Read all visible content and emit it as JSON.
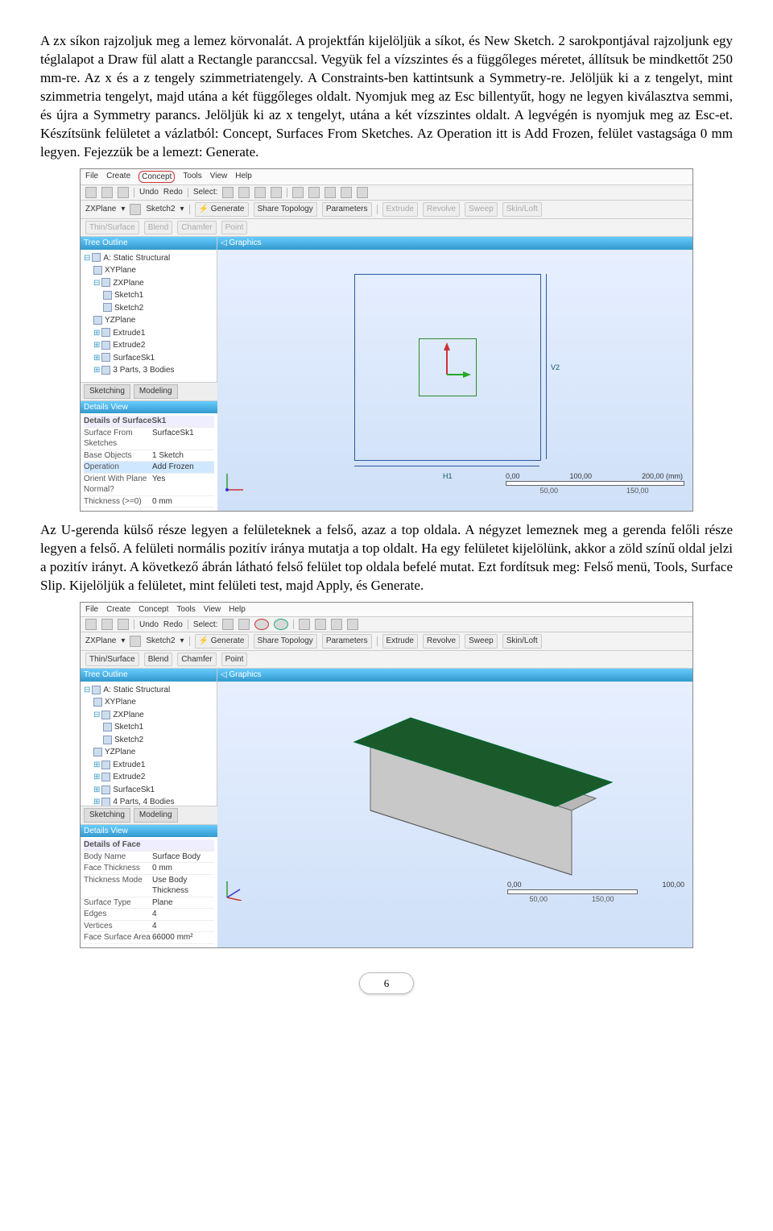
{
  "para1": "A zx síkon rajzoljuk meg a lemez körvonalát. A projektfán kijelöljük a síkot, és New Sketch. 2 sarokpontjával rajzoljunk egy téglalapot a Draw fül alatt a Rectangle paranccsal. Vegyük fel a vízszintes és a függőleges méretet, állítsuk be mindkettőt 250 mm-re. Az x és a z tengely szimmetriatengely. A Constraints-ben kattintsunk a Symmetry-re. Jelöljük ki a z tengelyt, mint szimmetria tengelyt, majd utána a két függőleges oldalt. Nyomjuk meg az Esc billentyűt, hogy ne legyen kiválasztva semmi, és újra a Symmetry parancs. Jelöljük ki az x tengelyt, utána a két vízszintes oldalt. A legvégén is nyomjuk meg az Esc-et. Készítsünk felületet a vázlatból: Concept, Surfaces From Sketches. Az Operation itt is Add Frozen, felület vastagsága 0 mm legyen. Fejezzük be a lemezt: Generate.",
  "para2": "Az U-gerenda külső része legyen a felületeknek a felső, azaz a top oldala. A négyzet lemeznek meg a gerenda felőli része legyen a felső. A felületi normális pozitív iránya mutatja a top oldalt. Ha egy felületet kijelölünk, akkor a zöld színű oldal jelzi a pozitív irányt. A következő ábrán látható felső felület top oldala befelé mutat. Ezt fordítsuk meg: Felső menü, Tools, Surface Slip. Kijelöljük a felületet, mint felületi test, majd Apply, és Generate.",
  "menu": {
    "file": "File",
    "create": "Create",
    "concept": "Concept",
    "tools": "Tools",
    "view": "View",
    "help": "Help"
  },
  "tb": {
    "undo": "Undo",
    "redo": "Redo",
    "select": "Select:",
    "generate": "Generate",
    "sharetopo": "Share Topology",
    "parameters": "Parameters",
    "extrude": "Extrude",
    "revolve": "Revolve",
    "sweep": "Sweep",
    "skinloft": "Skin/Loft",
    "thinsurf": "Thin/Surface",
    "blend": "Blend",
    "chamfer": "Chamfer",
    "point": "Point"
  },
  "plane1": "ZXPlane",
  "sketch1": "Sketch2",
  "tree1": {
    "title": "Tree Outline",
    "root": "A: Static Structural",
    "items": [
      "XYPlane",
      "ZXPlane",
      "Sketch1",
      "Sketch2",
      "YZPlane",
      "Extrude1",
      "Extrude2",
      "SurfaceSk1",
      "3 Parts, 3 Bodies"
    ]
  },
  "tabs": {
    "sketching": "Sketching",
    "modeling": "Modeling"
  },
  "dv1": {
    "title": "Details View",
    "header": "Details of SurfaceSk1",
    "r1k": "Surface From Sketches",
    "r1v": "SurfaceSk1",
    "r2k": "Base Objects",
    "r2v": "1 Sketch",
    "r3k": "Operation",
    "r3v": "Add Frozen",
    "r4k": "Orient With Plane Normal?",
    "r4v": "Yes",
    "r5k": "Thickness (>=0)",
    "r5v": "0 mm"
  },
  "ruler1": {
    "u": "(mm)",
    "t0": "0,00",
    "t1": "100,00",
    "t2": "200,00",
    "m1": "50,00",
    "m2": "150,00"
  },
  "graphics_label": "Graphics",
  "dim_h": "H1",
  "dim_v": "V2",
  "tree2": {
    "title": "Tree Outline",
    "root": "A: Static Structural",
    "items": [
      "XYPlane",
      "ZXPlane",
      "Sketch1",
      "Sketch2",
      "YZPlane",
      "Extrude1",
      "Extrude2",
      "SurfaceSk1",
      "4 Parts, 4 Bodies"
    ]
  },
  "dv2": {
    "title": "Details View",
    "header": "Details of Face",
    "r1k": "Body Name",
    "r1v": "Surface Body",
    "r2k": "Face Thickness",
    "r2v": "0 mm",
    "r3k": "Thickness Mode",
    "r3v": "Use Body Thickness",
    "r4k": "Surface Type",
    "r4v": "Plane",
    "r5k": "Edges",
    "r5v": "4",
    "r6k": "Vertices",
    "r6v": "4",
    "r7k": "Face Surface Area",
    "r7v": "66000 mm²"
  },
  "ruler2": {
    "t0": "0,00",
    "t1": "100,00",
    "m1": "50,00",
    "m2": "150,00"
  },
  "page": "6"
}
